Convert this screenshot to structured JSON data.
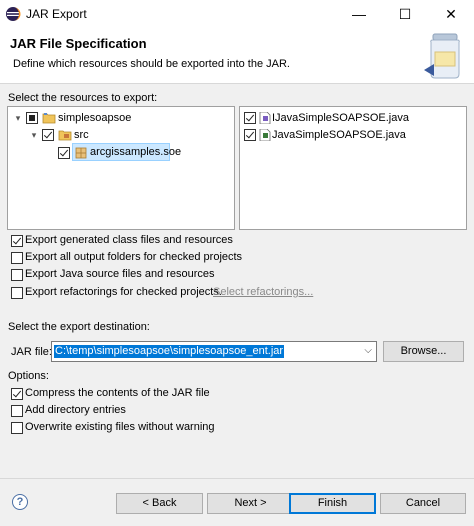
{
  "window": {
    "title": "JAR Export",
    "minimize_glyph": "—",
    "maximize_glyph": "☐",
    "close_glyph": "✕"
  },
  "banner": {
    "heading": "JAR File Specification",
    "description": "Define which resources should be exported into the JAR."
  },
  "resources": {
    "label": "Select the resources to export:",
    "tree": [
      {
        "label": "simplesoapsoe",
        "state": "partial",
        "expanded": true
      },
      {
        "label": "src",
        "state": "checked",
        "expanded": true
      },
      {
        "label": "arcgissamples.soe",
        "state": "checked",
        "selected": true
      }
    ],
    "files": [
      {
        "label": "IJavaSimpleSOAPSOE.java",
        "state": "checked"
      },
      {
        "label": "JavaSimpleSOAPSOE.java",
        "state": "checked"
      }
    ]
  },
  "export_options": [
    {
      "label": "Export generated class files and resources",
      "checked": true
    },
    {
      "label": "Export all output folders for checked projects",
      "checked": false
    },
    {
      "label": "Export Java source files and resources",
      "checked": false
    },
    {
      "label": "Export refactorings for checked projects.",
      "checked": false,
      "link": "Select refactorings..."
    }
  ],
  "destination": {
    "label": "Select the export destination:",
    "field_label": "JAR file:",
    "value": "C:\\temp\\simplesoapsoe\\simplesoapsoe_ent.jar",
    "browse_label": "Browse..."
  },
  "options": {
    "label": "Options:",
    "items": [
      {
        "label": "Compress the contents of the JAR file",
        "checked": true
      },
      {
        "label": "Add directory entries",
        "checked": false
      },
      {
        "label": "Overwrite existing files without warning",
        "checked": false
      }
    ]
  },
  "footer": {
    "help_glyph": "?",
    "back_label": "< Back",
    "next_label": "Next >",
    "finish_label": "Finish",
    "cancel_label": "Cancel"
  }
}
